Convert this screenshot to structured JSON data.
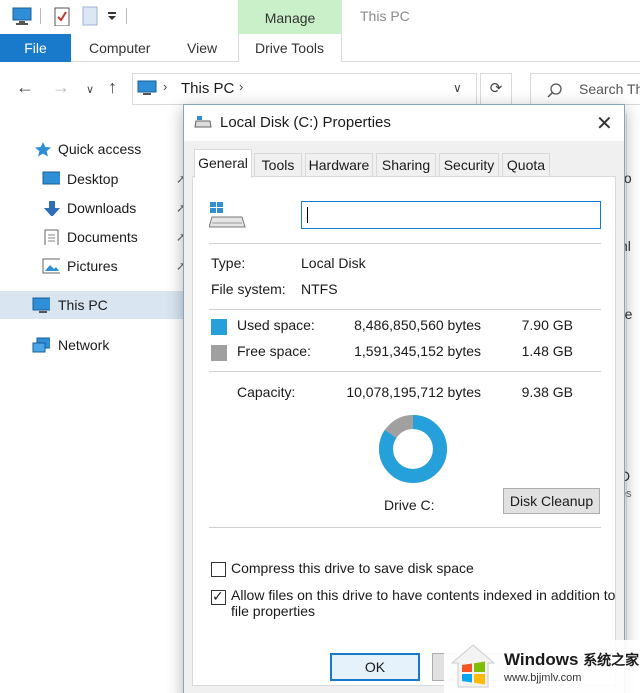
{
  "explorer": {
    "window_title": "This PC",
    "manage_tab": "Manage",
    "ribbon_tabs": {
      "file": "File",
      "computer": "Computer",
      "view": "View",
      "drive_tools": "Drive Tools"
    },
    "address": "This PC",
    "search_placeholder": "Search Th",
    "nav": {
      "quick_access": "Quick access",
      "desktop": "Desktop",
      "downloads": "Downloads",
      "documents": "Documents",
      "pictures": "Pictures",
      "this_pc": "This PC",
      "network": "Network"
    },
    "right_fragments": [
      "to",
      "nl",
      "re",
      "D",
      "es"
    ]
  },
  "dialog": {
    "title": "Local Disk (C:) Properties",
    "tabs": [
      "General",
      "Tools",
      "Hardware",
      "Sharing",
      "Security",
      "Quota"
    ],
    "active_tab": "General",
    "name_value": "",
    "type_label": "Type:",
    "type_value": "Local Disk",
    "fs_label": "File system:",
    "fs_value": "NTFS",
    "used_label": "Used space:",
    "used_bytes": "8,486,850,560 bytes",
    "used_gb": "7.90 GB",
    "free_label": "Free space:",
    "free_bytes": "1,591,345,152 bytes",
    "free_gb": "1.48 GB",
    "capacity_label": "Capacity:",
    "capacity_bytes": "10,078,195,712 bytes",
    "capacity_gb": "9.38 GB",
    "used_fraction": 0.842,
    "drive_label": "Drive C:",
    "cleanup_button": "Disk Cleanup",
    "compress_label": "Compress this drive to save disk space",
    "compress_checked": false,
    "index_label_line1": "Allow files on this drive to have contents indexed in addition to",
    "index_label_line2": "file properties",
    "index_checked": true,
    "ok_button": "OK",
    "colors": {
      "used": "#26a0da",
      "free": "#a0a0a0",
      "accent": "#1979ca"
    }
  },
  "watermark": {
    "brand": "Windows",
    "brand_cn": "系统之家",
    "url": "www.bjjmlv.com"
  }
}
